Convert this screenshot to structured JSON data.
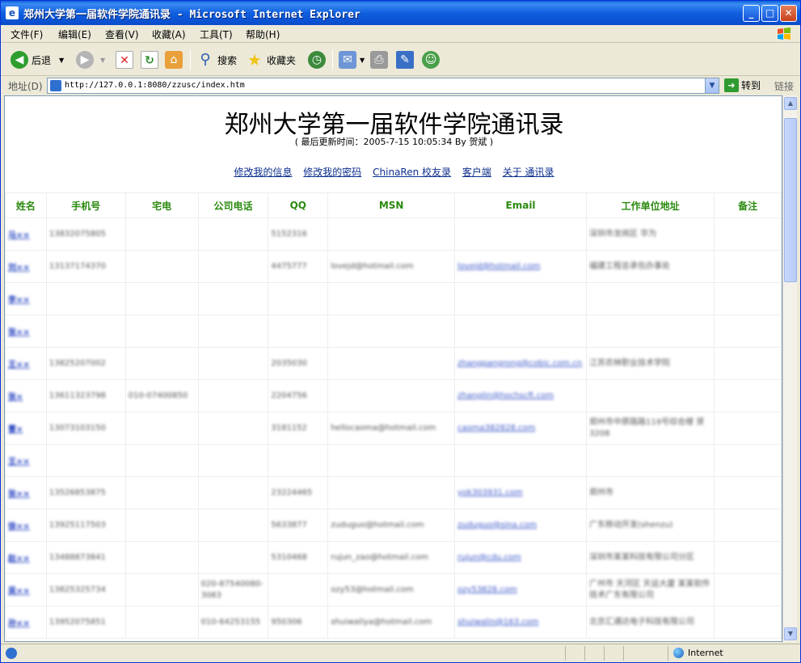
{
  "window": {
    "title": "郑州大学第一届软件学院通讯录 - Microsoft Internet Explorer"
  },
  "menu": [
    "文件(F)",
    "编辑(E)",
    "查看(V)",
    "收藏(A)",
    "工具(T)",
    "帮助(H)"
  ],
  "toolbar": {
    "back": "后退",
    "search": "搜索",
    "favorites": "收藏夹"
  },
  "address": {
    "label": "地址(D)",
    "url": "http://127.0.0.1:8080/zzusc/index.htm",
    "go": "转到",
    "links": "链接"
  },
  "page": {
    "title": "郑州大学第一届软件学院通讯录",
    "updated": "( 最后更新时间：2005-7-15 10:05:34 By 贺斌 )",
    "nav": [
      "修改我的信息",
      "修改我的密码",
      "ChinaRen 校友录",
      "客户端",
      "关于 通讯录"
    ]
  },
  "table": {
    "headers": [
      "姓名",
      "手机号",
      "宅电",
      "公司电话",
      "QQ",
      "MSN",
      "Email",
      "工作单位地址",
      "备注"
    ],
    "rows": [
      [
        "马××",
        "13832075805",
        "",
        "",
        "5152316",
        "",
        "",
        "深圳市龙岗区 华为",
        ""
      ],
      [
        "刘××",
        "13137174370",
        "",
        "",
        "4475777",
        "lovejd@hotmail.com",
        "lovejd@hotmail.com",
        "福建工程总承包办事处",
        ""
      ],
      [
        "李××",
        "",
        "",
        "",
        "",
        "",
        "",
        "",
        ""
      ],
      [
        "张××",
        "",
        "",
        "",
        "",
        "",
        "",
        "",
        ""
      ],
      [
        "王××",
        "13825207002",
        "",
        "",
        "2035030",
        "",
        "zhangpangrong@cobic.com.cn",
        "江苏农林职业技术学院",
        ""
      ],
      [
        "张×",
        "13611323798",
        "010-07400850",
        "",
        "2204756",
        "",
        "zhanglin@hochscft.com",
        "",
        ""
      ],
      [
        "曹×",
        "13073103150",
        "",
        "",
        "3181152",
        "hellocaoma@hotmail.com",
        "caoma382828.com",
        "郑州市中原路路119号综合楼 贤3208",
        ""
      ],
      [
        "王××",
        "",
        "",
        "",
        "",
        "",
        "",
        "",
        ""
      ],
      [
        "张××",
        "13526853875",
        "",
        "",
        "23224465",
        "",
        "yok303931.com",
        "郑州市",
        ""
      ],
      [
        "徐××",
        "13925117503",
        "",
        "",
        "5633877",
        "zuduguo@hotmail.com",
        "zuduguo@sina.com",
        "广东移动开发(shenzu)",
        ""
      ],
      [
        "赵××",
        "13488873841",
        "",
        "",
        "5310468",
        "rujun_zao@hotmail.com",
        "rujun@cdu.com",
        "深圳市某某科技有限公司分区",
        ""
      ],
      [
        "吴××",
        "13825325734",
        "",
        "020-87540080-3083",
        "",
        "ozy53@hotmail.com",
        "ozy53828.com",
        "广州市 天河区 天运大厦 某某软件技术广东有限公司",
        ""
      ],
      [
        "孙××",
        "13952075851",
        "",
        "010-64253155",
        "950306",
        "shuiwaliya@hotmail.com",
        "shuiwalin@163.com",
        "北京汇通达电子科技有限公司",
        ""
      ]
    ]
  },
  "status": {
    "zone": "Internet"
  },
  "icons": [
    "ie-page-icon",
    "back-arrow-icon",
    "forward-arrow-icon",
    "stop-icon",
    "refresh-icon",
    "home-icon",
    "search-icon",
    "favorites-star-icon",
    "history-icon",
    "mail-icon",
    "print-icon",
    "edit-icon",
    "messenger-icon",
    "globe-icon"
  ]
}
